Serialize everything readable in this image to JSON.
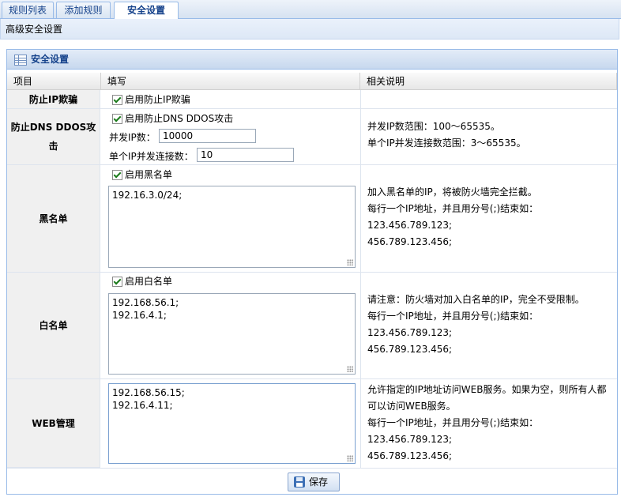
{
  "tabs": [
    {
      "label": "规则列表",
      "active": false
    },
    {
      "label": "添加规则",
      "active": false
    },
    {
      "label": "安全设置",
      "active": true
    }
  ],
  "subheader": {
    "title": "高级安全设置"
  },
  "panel": {
    "title": "安全设置",
    "columns": [
      "项目",
      "填写",
      "相关说明"
    ]
  },
  "rows": {
    "ip_spoof": {
      "label": "防止IP欺骗",
      "checkbox_label": "启用防止IP欺骗",
      "checked": true
    },
    "dns_ddos": {
      "label": "防止DNS DDOS攻击",
      "checkbox_label": "启用防止DNS DDOS攻击",
      "checked": true,
      "concurrent_label": "并发IP数：",
      "concurrent_value": "10000",
      "per_ip_label": "单个IP并发连接数：",
      "per_ip_value": "10",
      "desc": [
        "并发IP数范围：100～65535。",
        "单个IP并发连接数范围：3～65535。"
      ]
    },
    "blacklist": {
      "label": "黑名单",
      "checkbox_label": "启用黑名单",
      "checked": true,
      "value": "192.16.3.0/24;",
      "desc": [
        "加入黑名单的IP，将被防火墙完全拦截。",
        "每行一个IP地址，并且用分号(;)结束如：",
        "123.456.789.123;",
        "456.789.123.456;"
      ]
    },
    "whitelist": {
      "label": "白名单",
      "checkbox_label": "启用白名单",
      "checked": true,
      "value": "192.168.56.1;\n192.16.4.1;",
      "desc": [
        "请注意：防火墙对加入白名单的IP，完全不受限制。",
        "每行一个IP地址，并且用分号(;)结束如：",
        "123.456.789.123;",
        "456.789.123.456;"
      ]
    },
    "web": {
      "label": "WEB管理",
      "value": "192.168.56.15;\n192.16.4.11;",
      "desc": [
        "允许指定的IP地址访问WEB服务。如果为空，则所有人都",
        "可以访问WEB服务。",
        "每行一个IP地址，并且用分号(;)结束如：",
        "123.456.789.123;",
        "456.789.123.456;"
      ]
    }
  },
  "save_label": "保存",
  "colors": {
    "accent": "#15428b",
    "border": "#99bbe8",
    "label_bg": "#f0f0f0"
  }
}
